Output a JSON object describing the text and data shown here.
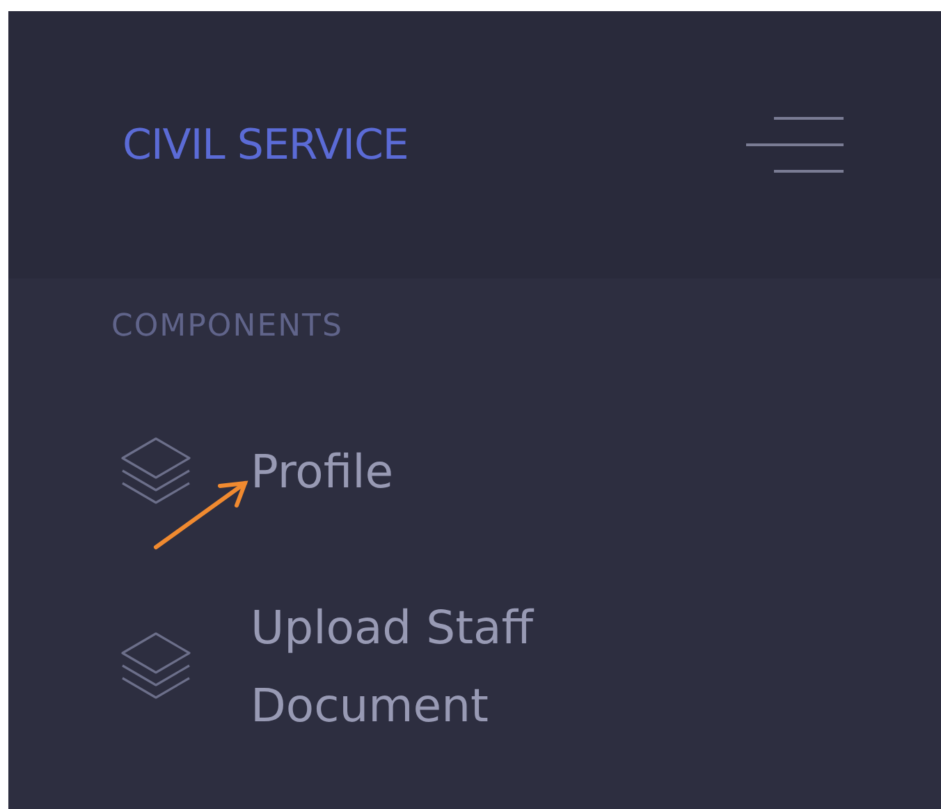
{
  "brand": "CIVIL SERVICE",
  "section_heading": "COMPONENTS",
  "menu_items": [
    {
      "label": "Profile",
      "annotated": true
    },
    {
      "label": "Upload Staff Document",
      "annotated": false
    }
  ]
}
